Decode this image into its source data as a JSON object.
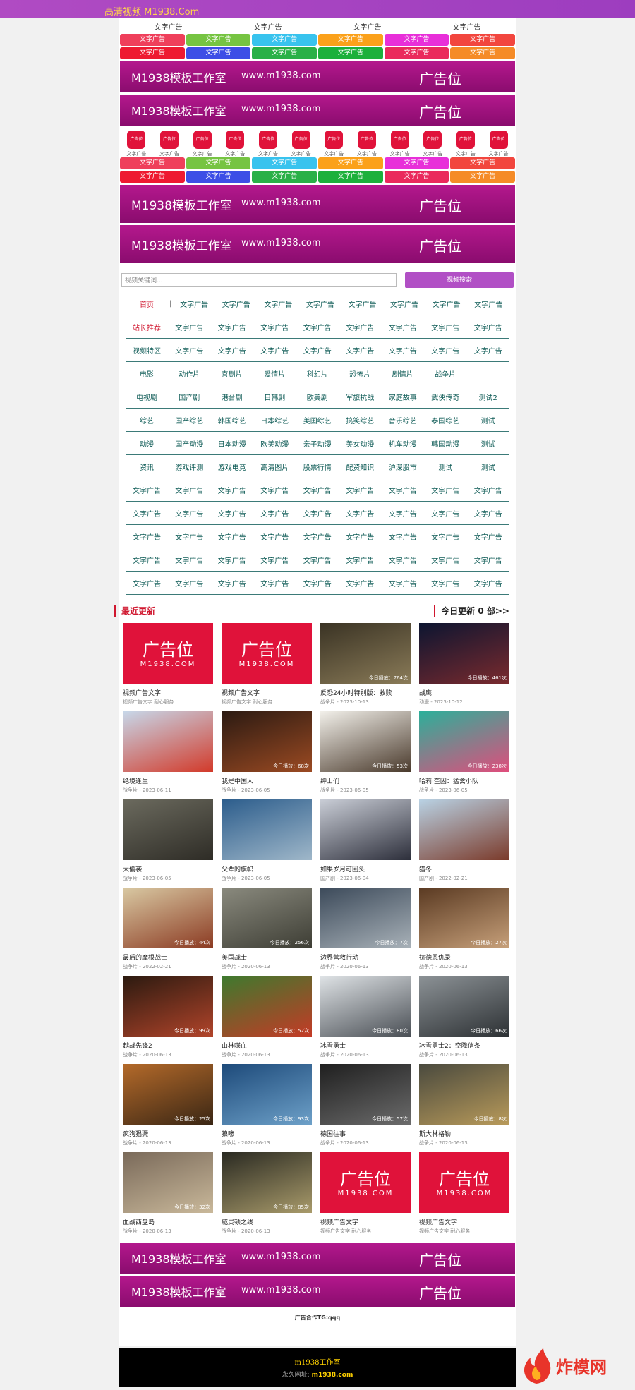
{
  "header": {
    "brand": "高清视频 M1938.Com"
  },
  "text_ads": [
    "文字广告",
    "文字广告",
    "文字广告",
    "文字广告"
  ],
  "color_ads": {
    "label": "文字广告",
    "colors": [
      "#ef3f5b",
      "#76c442",
      "#38c3ee",
      "#fba11a",
      "#e82fd9",
      "#f2463e",
      "#ee1a31",
      "#3d4ee6",
      "#29b047",
      "#1cb03b",
      "#ea2a5c",
      "#f58b27"
    ]
  },
  "banner": {
    "studio": "M1938模板工作室",
    "url": "www.m1938.com",
    "slot": "广告位"
  },
  "icons": {
    "icon_text": "广告位",
    "caption": "文字广告",
    "count": 12
  },
  "search": {
    "placeholder": "视频关键词...",
    "button": "视频搜索"
  },
  "nav": [
    {
      "label": "首页",
      "label_color": "#d0172f",
      "items": [
        "文字广告",
        "文字广告",
        "文字广告",
        "文字广告",
        "文字广告",
        "文字广告",
        "文字广告",
        "文字广告"
      ]
    },
    {
      "label": "站长推荐",
      "label_color": "#d0172f",
      "items": [
        "文字广告",
        "文字广告",
        "文字广告",
        "文字广告",
        "文字广告",
        "文字广告",
        "文字广告",
        "文字广告"
      ]
    },
    {
      "label": "视频特区",
      "items": [
        "文字广告",
        "文字广告",
        "文字广告",
        "文字广告",
        "文字广告",
        "文字广告",
        "文字广告",
        "文字广告"
      ]
    },
    {
      "label": "电影",
      "items": [
        "动作片",
        "喜剧片",
        "爱情片",
        "科幻片",
        "恐怖片",
        "剧情片",
        "战争片",
        ""
      ]
    },
    {
      "label": "电视剧",
      "items": [
        "国产剧",
        "港台剧",
        "日韩剧",
        "欧美剧",
        "军旅抗战",
        "家庭故事",
        "武侠传奇",
        "测试2"
      ]
    },
    {
      "label": "综艺",
      "items": [
        "国产综艺",
        "韩国综艺",
        "日本综艺",
        "美国综艺",
        "搞笑综艺",
        "音乐综艺",
        "泰国综艺",
        "测试"
      ]
    },
    {
      "label": "动漫",
      "items": [
        "国产动漫",
        "日本动漫",
        "欧美动漫",
        "亲子动漫",
        "美女动漫",
        "机车动漫",
        "韩国动漫",
        "测试"
      ]
    },
    {
      "label": "资讯",
      "items": [
        "游戏评测",
        "游戏电竞",
        "高清图片",
        "股票行情",
        "配资知识",
        "沪深股市",
        "测试",
        "测试"
      ]
    },
    {
      "label": "文字广告",
      "items": [
        "文字广告",
        "文字广告",
        "文字广告",
        "文字广告",
        "文字广告",
        "文字广告",
        "文字广告",
        "文字广告"
      ]
    },
    {
      "label": "文字广告",
      "items": [
        "文字广告",
        "文字广告",
        "文字广告",
        "文字广告",
        "文字广告",
        "文字广告",
        "文字广告",
        "文字广告"
      ]
    },
    {
      "label": "文字广告",
      "items": [
        "文字广告",
        "文字广告",
        "文字广告",
        "文字广告",
        "文字广告",
        "文字广告",
        "文字广告",
        "文字广告"
      ]
    },
    {
      "label": "文字广告",
      "items": [
        "文字广告",
        "文字广告",
        "文字广告",
        "文字广告",
        "文字广告",
        "文字广告",
        "文字广告",
        "文字广告"
      ]
    },
    {
      "label": "文字广告",
      "items": [
        "文字广告",
        "文字广告",
        "文字广告",
        "文字广告",
        "文字广告",
        "文字广告",
        "文字广告",
        "文字广告"
      ]
    }
  ],
  "section": {
    "title": "最近更新",
    "today": "今日更新 0 部>>"
  },
  "ad_poster": {
    "big": "广告位",
    "small": "M1938.COM"
  },
  "videos": [
    {
      "ad": true,
      "title": "视频广告文字",
      "meta": "视频广告文字 耐心服务"
    },
    {
      "ad": true,
      "title": "视频广告文字",
      "meta": "视频广告文字 耐心服务"
    },
    {
      "title": "反恐24小时特别版：救赎",
      "meta": "战争片 - 2023-10-13",
      "badge": "今日播放：764次",
      "c1": "#3a3324",
      "c2": "#8a7b58"
    },
    {
      "title": "战鹰",
      "meta": "动漫 - 2023-10-12",
      "badge": "今日播放：461次",
      "c1": "#0c1530",
      "c2": "#7a2a2e"
    },
    {
      "title": "绝境逢生",
      "meta": "战争片 - 2023-06-11",
      "badge": "",
      "c1": "#c7d8ea",
      "c2": "#d23a2a"
    },
    {
      "title": "我是中国人",
      "meta": "战争片 - 2023-06-05",
      "badge": "今日播放：68次",
      "c1": "#2b1a12",
      "c2": "#9b4a22"
    },
    {
      "title": "绅士们",
      "meta": "战争片 - 2023-06-05",
      "badge": "今日播放：53次",
      "c1": "#f2f0ea",
      "c2": "#4a3a2c"
    },
    {
      "title": "哈莉·奎因：猛禽小队",
      "meta": "战争片 - 2023-06-05",
      "badge": "今日播放：238次",
      "c1": "#2bb09a",
      "c2": "#e04d7c"
    },
    {
      "title": "大偷袭",
      "meta": "战争片 - 2023-06-05",
      "badge": "",
      "c1": "#6b6a5e",
      "c2": "#2e2c26"
    },
    {
      "title": "父辈的旗帜",
      "meta": "战争片 - 2023-06-05",
      "badge": "",
      "c1": "#2c5d8c",
      "c2": "#9fb7c9"
    },
    {
      "title": "如果岁月可回头",
      "meta": "国产剧 - 2023-06-04",
      "badge": "",
      "c1": "#c9cdd6",
      "c2": "#2d2f3b"
    },
    {
      "title": "猫冬",
      "meta": "国产剧 - 2022-02-21",
      "badge": "",
      "c1": "#b9d2e4",
      "c2": "#7b3a2a"
    },
    {
      "title": "最后的摩根战士",
      "meta": "战争片 - 2022-02-21",
      "badge": "今日播放：44次",
      "c1": "#d9c9a3",
      "c2": "#8b3a22"
    },
    {
      "title": "美国战士",
      "meta": "战争片 - 2020-06-13",
      "badge": "今日播放：256次",
      "c1": "#8a8a7e",
      "c2": "#3d3d34"
    },
    {
      "title": "边界营救行动",
      "meta": "战争片 - 2020-06-13",
      "badge": "今日播放：7次",
      "c1": "#3c4a5a",
      "c2": "#a8b1b8"
    },
    {
      "title": "抗德恩仇录",
      "meta": "战争片 - 2020-06-13",
      "badge": "今日播放：27次",
      "c1": "#5a3a22",
      "c2": "#c7a07a"
    },
    {
      "title": "越战先锋2",
      "meta": "战争片 - 2020-06-13",
      "badge": "今日播放：99次",
      "c1": "#2b1a10",
      "c2": "#b1442a"
    },
    {
      "title": "山林喋血",
      "meta": "战争片 - 2020-06-13",
      "badge": "今日播放：52次",
      "c1": "#3d7a2e",
      "c2": "#c43a26"
    },
    {
      "title": "冰雪勇士",
      "meta": "战争片 - 2020-06-13",
      "badge": "今日播放：80次",
      "c1": "#dfe3e6",
      "c2": "#4a4f55"
    },
    {
      "title": "冰雪勇士2：空降信条",
      "meta": "战争片 - 2020-06-13",
      "badge": "今日播放：66次",
      "c1": "#8c9296",
      "c2": "#2d3134"
    },
    {
      "title": "疯狗猖獗",
      "meta": "战争片 - 2020-06-13",
      "badge": "今日播放：25次",
      "c1": "#b46a2a",
      "c2": "#3a2614"
    },
    {
      "title": "狼嚎",
      "meta": "战争片 - 2020-06-13",
      "badge": "今日播放：93次",
      "c1": "#1d4a7a",
      "c2": "#6da0c8"
    },
    {
      "title": "德国往事",
      "meta": "战争片 - 2020-06-13",
      "badge": "今日播放：57次",
      "c1": "#1f1f1f",
      "c2": "#6b6b6b"
    },
    {
      "title": "斯大林格勒",
      "meta": "战争片 - 2020-06-13",
      "badge": "今日播放：8次",
      "c1": "#4a4a3e",
      "c2": "#b89a5a"
    },
    {
      "title": "血战西盘岛",
      "meta": "战争片 - 2020-06-13",
      "badge": "今日播放：32次",
      "c1": "#7a6a5a",
      "c2": "#c9b89a"
    },
    {
      "title": "威灵顿之线",
      "meta": "战争片 - 2020-06-13",
      "badge": "今日播放：85次",
      "c1": "#2a2a22",
      "c2": "#a89a6a"
    },
    {
      "ad": true,
      "title": "视频广告文字",
      "meta": "视频广告文字 耐心服务"
    },
    {
      "ad": true,
      "title": "视频广告文字",
      "meta": "视频广告文字 耐心服务"
    }
  ],
  "contact": "广告合作TG:qqq",
  "footer": {
    "studio": "m1938工作室",
    "permanent_label": "永久网址:",
    "permanent_url": "m1938.com"
  },
  "watermark": "炸模网"
}
